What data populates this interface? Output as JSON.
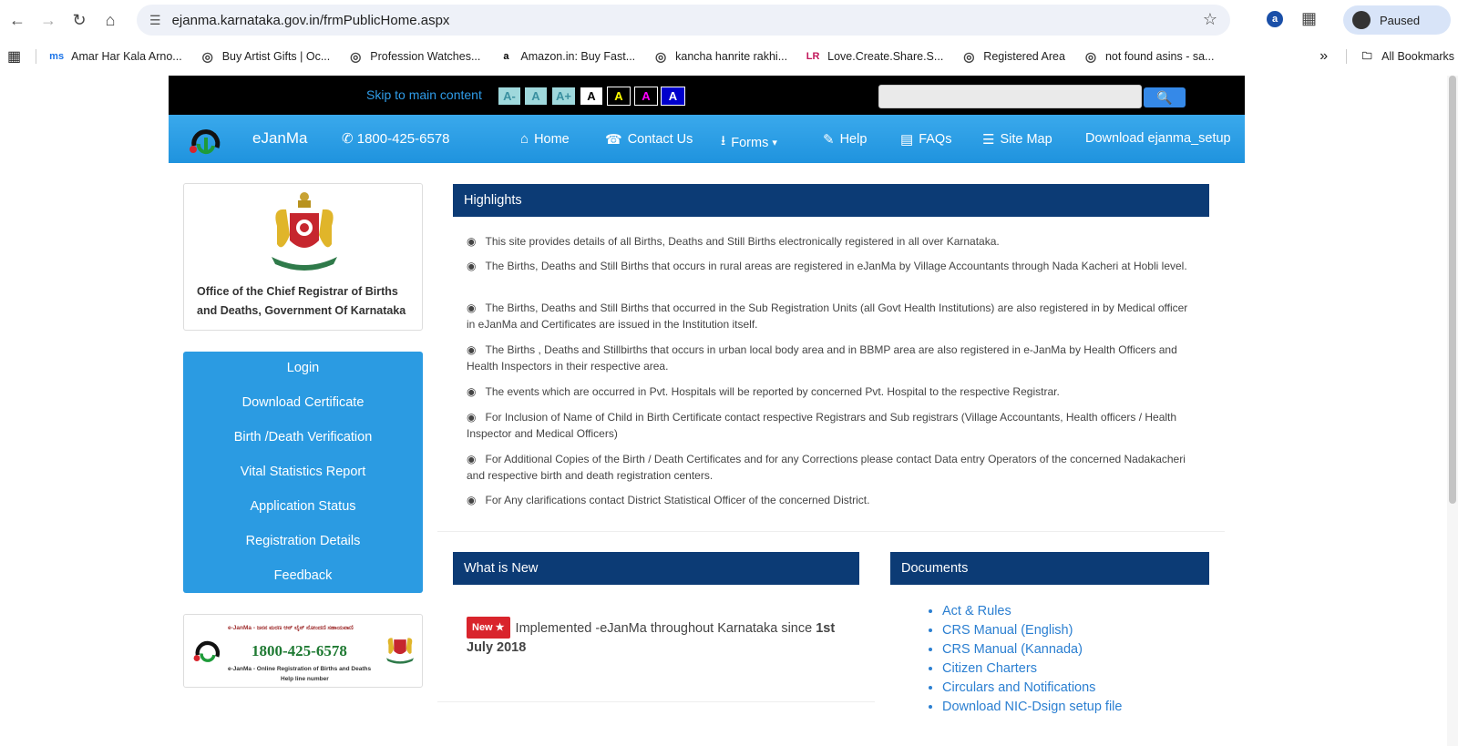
{
  "browser": {
    "url": "ejanma.karnataka.gov.in/frmPublicHome.aspx",
    "profile_status": "Paused",
    "ext_letter": "a",
    "bookmarks": [
      {
        "label": "Amar Har Kala Arno...",
        "icon": "ms",
        "color": "#1a73e8"
      },
      {
        "label": "Buy Artist Gifts | Oc...",
        "icon": "globe-icon",
        "color": "#444"
      },
      {
        "label": "Profession Watches...",
        "icon": "globe-icon",
        "color": "#444"
      },
      {
        "label": "Amazon.in: Buy Fast...",
        "icon": "a",
        "color": "#000"
      },
      {
        "label": "kancha hanrite rakhi...",
        "icon": "globe-icon",
        "color": "#444"
      },
      {
        "label": "Love.Create.Share.S...",
        "icon": "LR",
        "color": "#c2185b"
      },
      {
        "label": "Registered Area",
        "icon": "globe-icon",
        "color": "#444"
      },
      {
        "label": "not found asins - sa...",
        "icon": "globe-icon",
        "color": "#444"
      }
    ],
    "all_bookmarks": "All Bookmarks"
  },
  "topbar": {
    "skip_link": "Skip to main content",
    "font_buttons": [
      {
        "label": "A-",
        "bg": "#9fd8dc",
        "fg": "#3a90a0"
      },
      {
        "label": "A",
        "bg": "#9fd8dc",
        "fg": "#3a90a0"
      },
      {
        "label": "A+",
        "bg": "#9fd8dc",
        "fg": "#3a90a0"
      },
      {
        "label": "A",
        "bg": "#ffffff",
        "fg": "#000000"
      },
      {
        "label": "A",
        "bg": "#000000",
        "fg": "#ffff00"
      },
      {
        "label": "A",
        "bg": "#000000",
        "fg": "#ff00ff"
      },
      {
        "label": "A",
        "bg": "#0000cc",
        "fg": "#ffffff"
      }
    ],
    "search_placeholder": ""
  },
  "navbar": {
    "brand": "eJanMa",
    "phone": "1800-425-6578",
    "menu": [
      {
        "label": "Home",
        "icon": "home-icon"
      },
      {
        "label": "Contact Us",
        "icon": "phone-icon"
      },
      {
        "label": "Forms",
        "icon": "download-icon"
      },
      {
        "label": "Help",
        "icon": "pencil-icon"
      },
      {
        "label": "FAQs",
        "icon": "book-icon"
      },
      {
        "label": "Site Map",
        "icon": "list-icon"
      },
      {
        "label": "Download ejanma_setup",
        "icon": ""
      }
    ]
  },
  "office": {
    "name": "Office of the Chief Registrar of Births and Deaths, Government Of Karnataka"
  },
  "quick_links": [
    "Login",
    "Download Certificate",
    "Birth /Death Verification",
    "Vital Statistics Report",
    "Application Status",
    "Registration Details",
    "Feedback"
  ],
  "helpline_banner": {
    "top": "e-JanMa - ಜನನ ಮರಣ ಆನ್ ಲೈನ್ ನೋಂದಣಿ ಸಹಾಯವಾಣಿ",
    "number": "1800-425-6578",
    "subtitle": "e-JanMa - Online Registration of Births and Deaths",
    "help": "Help line number"
  },
  "highlights": {
    "title": "Highlights",
    "items": [
      "This site provides details of all Births, Deaths and Still Births electronically registered in all over Karnataka.",
      "The Births, Deaths and Still Births that occurs in rural areas are registered in eJanMa by Village Accountants through Nada Kacheri at Hobli level.",
      "The Births, Deaths and Still Births that occurred in the Sub Registration Units (all Govt Health Institutions) are also registered in by Medical officer in eJanMa and Certificates are issued in the Institution itself.",
      "The Births , Deaths and Stillbirths that occurs in urban local body area and in BBMP area are also registered in e-JanMa by Health Officers and Health Inspectors in their respective area.",
      "The events which are occurred in Pvt. Hospitals will be reported by concerned Pvt. Hospital to the respective Registrar.",
      "For Inclusion of Name of Child in Birth Certificate contact respective Registrars and Sub registrars (Village Accountants, Health officers / Health Inspector and Medical Officers)",
      "For Additional Copies of the Birth / Death Certificates and for any Corrections please contact Data entry Operators of the concerned Nadakacheri and respective birth and death registration centers.",
      "For Any clarifications contact District Statistical Officer of the concerned District."
    ]
  },
  "whats_new": {
    "title": "What is New",
    "badge": "New ★",
    "text": "Implemented -eJanMa throughout Karnataka since",
    "text_bold": "1st July 2018"
  },
  "documents": {
    "title": "Documents",
    "items": [
      "Act & Rules",
      "CRS Manual (English)",
      "CRS Manual (Kannada)",
      "Citizen Charters",
      "Circulars and Notifications",
      "Download NIC-Dsign setup file"
    ]
  }
}
